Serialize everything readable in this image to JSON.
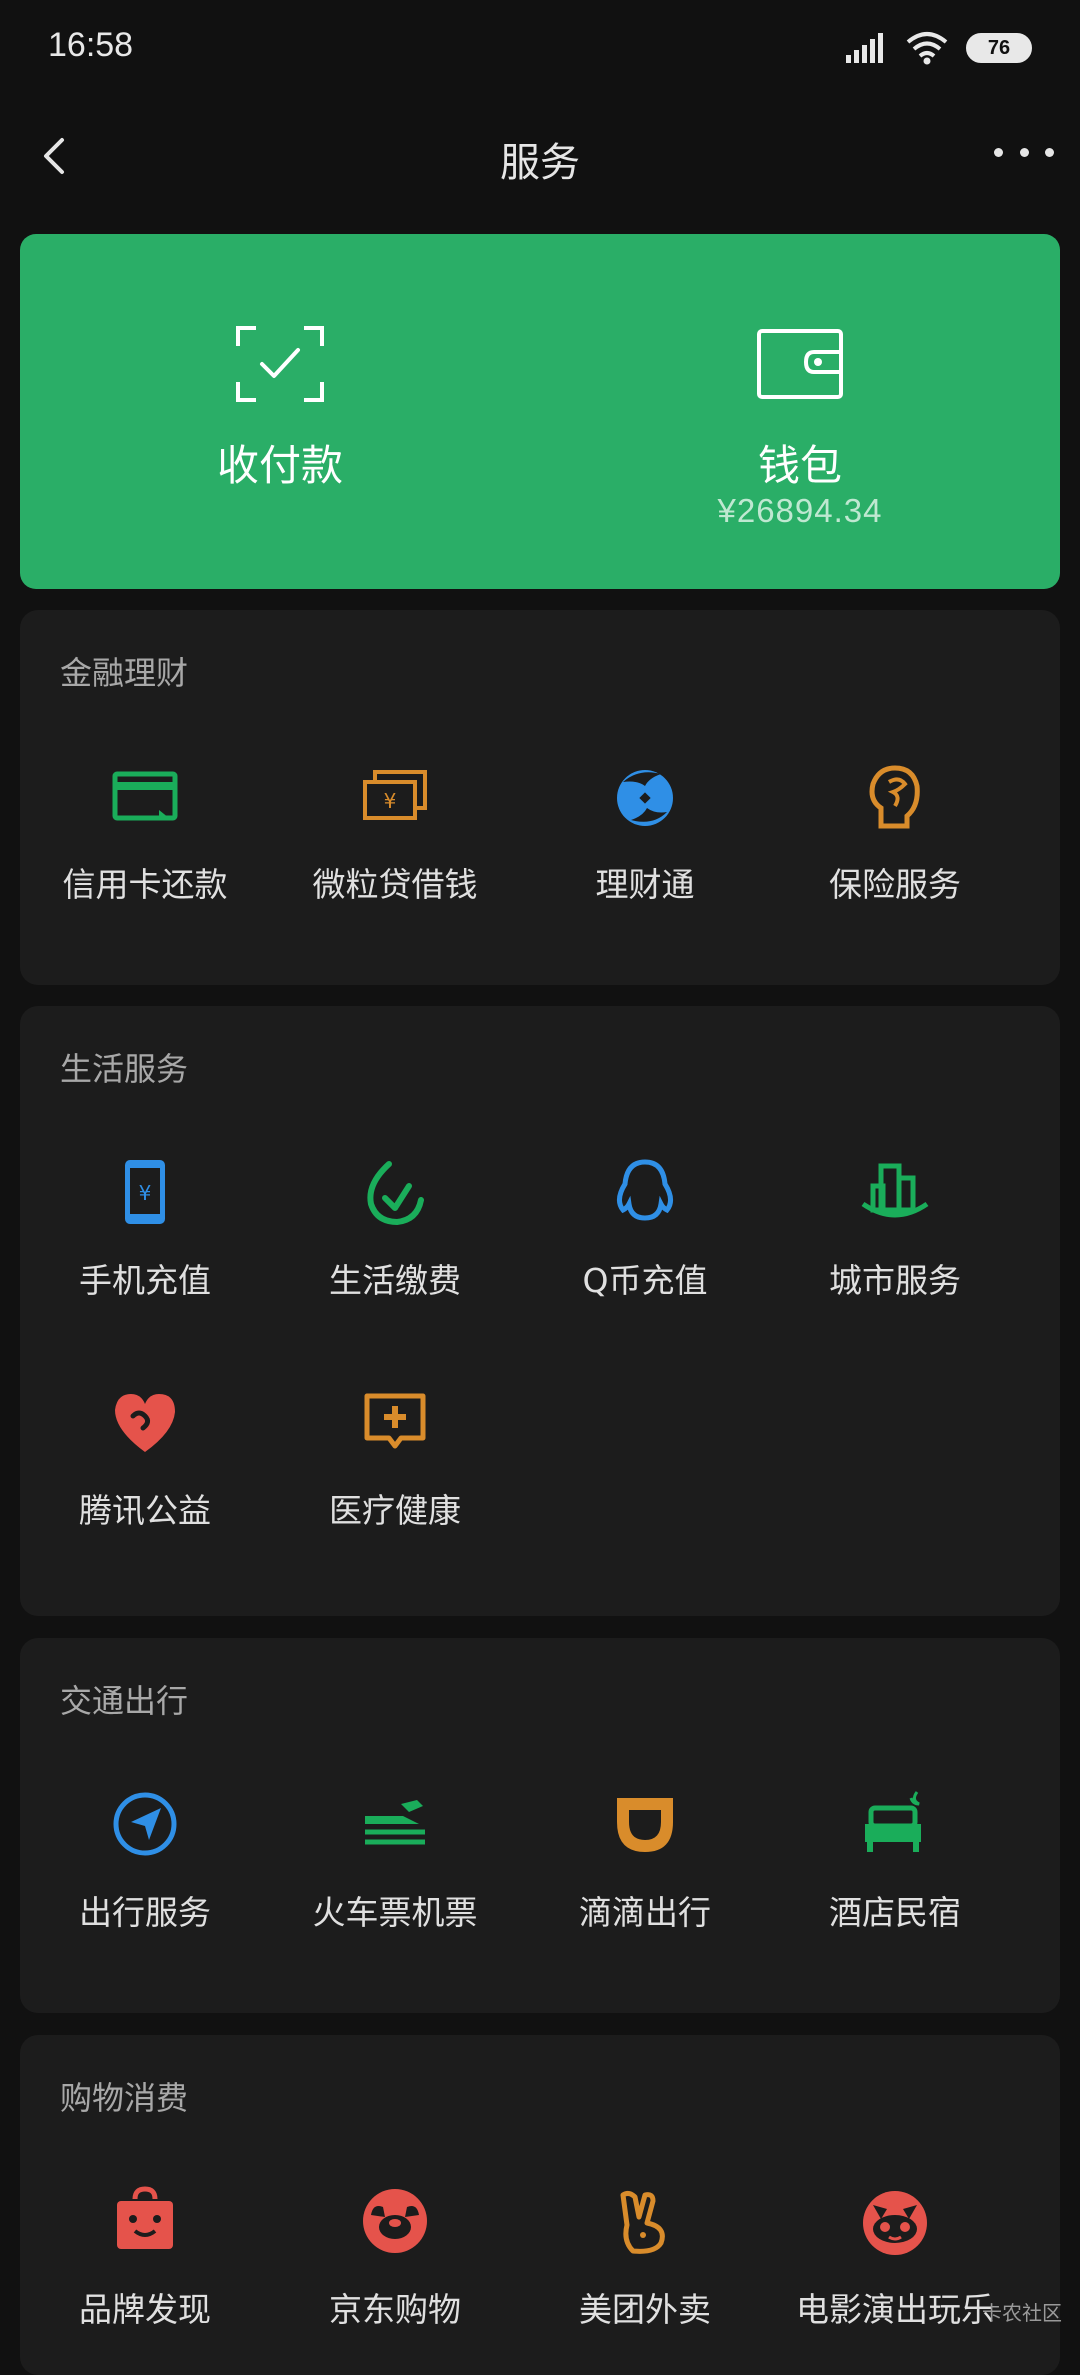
{
  "status_bar": {
    "time": "16:58",
    "battery": "76",
    "icons": [
      "signal-icon",
      "wifi-icon",
      "battery-icon"
    ]
  },
  "nav": {
    "title": "服务",
    "back_icon": "chevron-left-icon",
    "more_icon": "more-icon"
  },
  "hero": {
    "background": "#2aae67",
    "pay": {
      "label": "收付款",
      "icon": "scan-check-icon"
    },
    "wallet": {
      "label": "钱包",
      "balance": "¥26894.34",
      "icon": "wallet-icon"
    }
  },
  "sections": {
    "finance": {
      "title": "金融理财",
      "items": [
        {
          "label": "信用卡还款",
          "icon": "credit-card-icon",
          "color": "#1aad5a"
        },
        {
          "label": "微粒贷借钱",
          "icon": "loan-cards-icon",
          "color": "#d98c2b"
        },
        {
          "label": "理财通",
          "icon": "wealth-icon",
          "color": "#2f8fe6"
        },
        {
          "label": "保险服务",
          "icon": "insurance-icon",
          "color": "#d98c2b"
        }
      ]
    },
    "life": {
      "title": "生活服务",
      "items": [
        {
          "label": "手机充值",
          "icon": "phone-recharge-icon",
          "color": "#2f8fe6"
        },
        {
          "label": "生活缴费",
          "icon": "bill-pay-icon",
          "color": "#1aad5a"
        },
        {
          "label": "Q币充值",
          "icon": "qq-penguin-icon",
          "color": "#2f8fe6"
        },
        {
          "label": "城市服务",
          "icon": "city-icon",
          "color": "#1aad5a"
        },
        {
          "label": "腾讯公益",
          "icon": "charity-heart-icon",
          "color": "#e5534b"
        },
        {
          "label": "医疗健康",
          "icon": "medical-icon",
          "color": "#d98c2b"
        }
      ]
    },
    "travel": {
      "title": "交通出行",
      "items": [
        {
          "label": "出行服务",
          "icon": "navigation-icon",
          "color": "#2f8fe6"
        },
        {
          "label": "火车票机票",
          "icon": "train-plane-icon",
          "color": "#1aad5a"
        },
        {
          "label": "滴滴出行",
          "icon": "didi-icon",
          "color": "#d98c2b"
        },
        {
          "label": "酒店民宿",
          "icon": "hotel-bed-icon",
          "color": "#1aad5a"
        }
      ]
    },
    "shopping": {
      "title": "购物消费",
      "items": [
        {
          "label": "品牌发现",
          "icon": "brand-bag-icon",
          "color": "#e5534b"
        },
        {
          "label": "京东购物",
          "icon": "jd-dog-icon",
          "color": "#e5534b"
        },
        {
          "label": "美团外卖",
          "icon": "meituan-rabbit-icon",
          "color": "#d98c2b"
        },
        {
          "label": "电影演出玩乐",
          "icon": "maoyan-cat-icon",
          "color": "#e5534b"
        }
      ]
    }
  },
  "watermark": "卡农社区"
}
